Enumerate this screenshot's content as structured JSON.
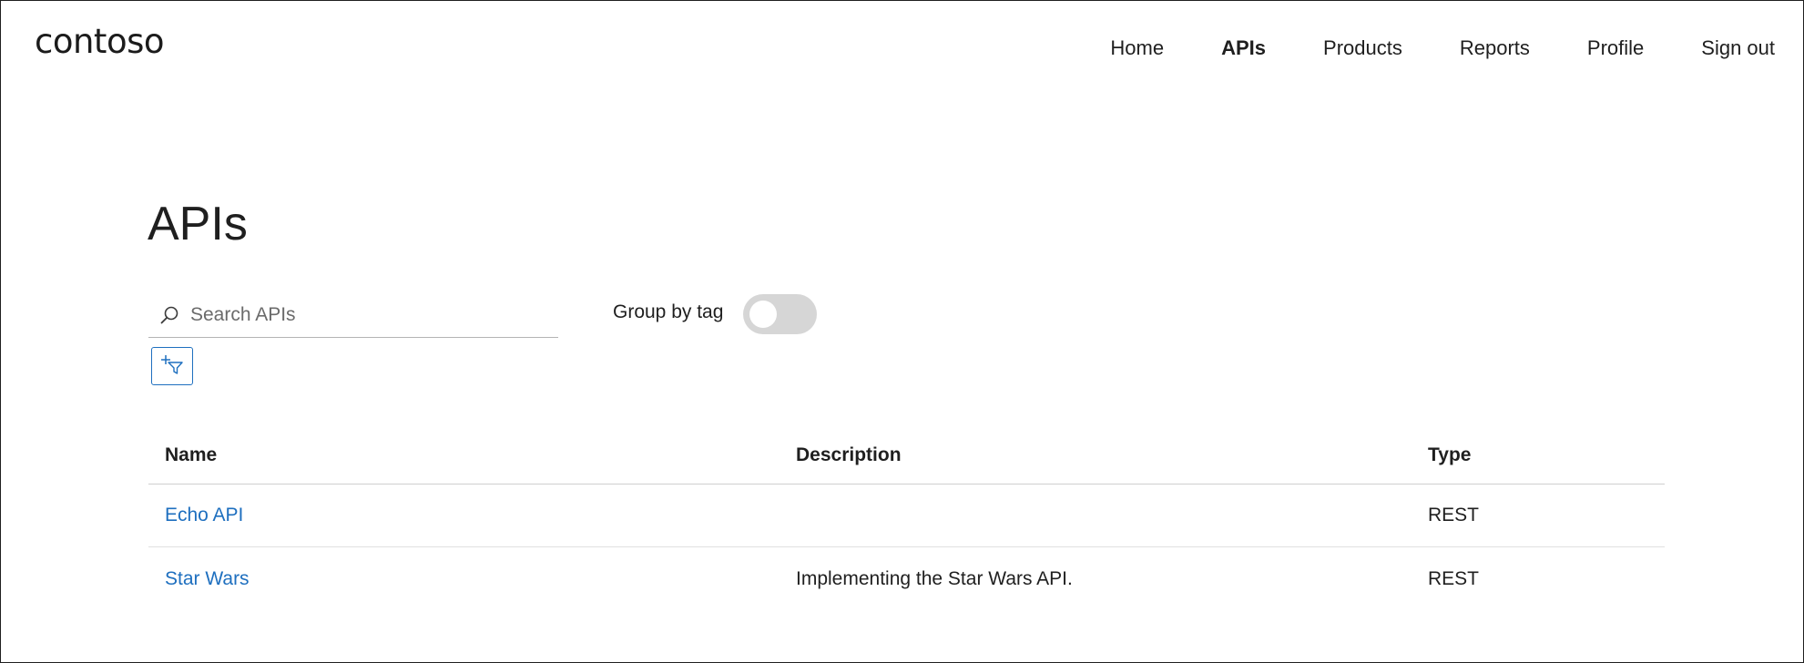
{
  "brand": {
    "logo_text": "contoso"
  },
  "nav": {
    "items": [
      {
        "label": "Home",
        "active": false
      },
      {
        "label": "APIs",
        "active": true
      },
      {
        "label": "Products",
        "active": false
      },
      {
        "label": "Reports",
        "active": false
      },
      {
        "label": "Profile",
        "active": false
      },
      {
        "label": "Sign out",
        "active": false
      }
    ]
  },
  "page": {
    "title": "APIs"
  },
  "search": {
    "placeholder": "Search APIs",
    "value": "",
    "icon": "search-icon"
  },
  "group_by_tag": {
    "label": "Group by tag",
    "enabled": false
  },
  "filter": {
    "icon": "add-filter-icon"
  },
  "table": {
    "headers": {
      "name": "Name",
      "description": "Description",
      "type": "Type"
    },
    "rows": [
      {
        "name": "Echo API",
        "description": "",
        "type": "REST"
      },
      {
        "name": "Star Wars",
        "description": "Implementing the Star Wars API.",
        "type": "REST"
      }
    ]
  },
  "colors": {
    "link": "#1e6fbf",
    "toggle_off": "#d6d6d6",
    "text": "#1f1f1f"
  }
}
